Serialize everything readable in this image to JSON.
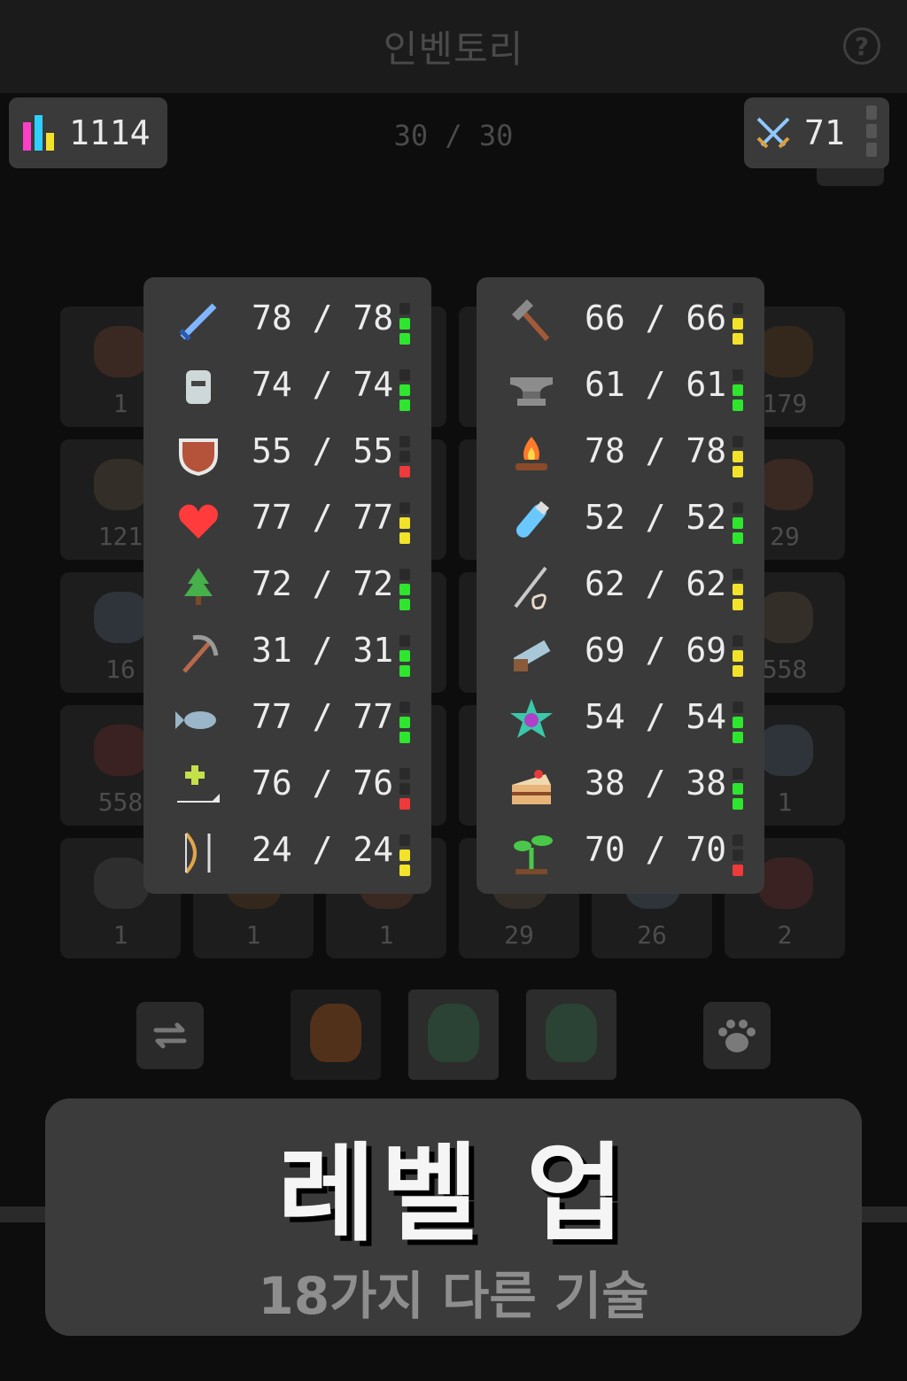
{
  "header": {
    "title": "인벤토리",
    "help_label": "?"
  },
  "player": {
    "total_level": "1114",
    "combat_level": "71"
  },
  "inventory": {
    "count_label": "30 / 30",
    "visible_quantities": [
      [
        "1",
        "",
        "",
        "",
        "",
        "179"
      ],
      [
        "121",
        "",
        "",
        "",
        "",
        "29"
      ],
      [
        "16",
        "",
        "",
        "",
        "",
        "558"
      ],
      [
        "558",
        "",
        "",
        "",
        "",
        "1"
      ],
      [
        "1",
        "1",
        "1",
        "29",
        "26",
        "2"
      ]
    ]
  },
  "skills_left": [
    {
      "icon": "sword-icon",
      "value": "78 / 78",
      "meter": "green",
      "color": "#7fb6ff"
    },
    {
      "icon": "helmet-icon",
      "value": "74 / 74",
      "meter": "green",
      "color": "#cfd8d8"
    },
    {
      "icon": "shield-icon",
      "value": "55 / 55",
      "meter": "red",
      "color": "#b5533a"
    },
    {
      "icon": "heart-icon",
      "value": "77 / 77",
      "meter": "yellow",
      "color": "#ff3b3b"
    },
    {
      "icon": "tree-icon",
      "value": "72 / 72",
      "meter": "green",
      "color": "#46b04a"
    },
    {
      "icon": "pickaxe-icon",
      "value": "31 / 31",
      "meter": "green",
      "color": "#b8684a"
    },
    {
      "icon": "fish-icon",
      "value": "77 / 77",
      "meter": "green",
      "color": "#9ab6c8"
    },
    {
      "icon": "healing-hand-icon",
      "value": "76 / 76",
      "meter": "red",
      "color": "#c4e04a"
    },
    {
      "icon": "bow-icon",
      "value": "24 / 24",
      "meter": "yellow",
      "color": "#e0a64a"
    }
  ],
  "skills_right": [
    {
      "icon": "hammer-icon",
      "value": "66 / 66",
      "meter": "yellow",
      "color": "#a35a3a"
    },
    {
      "icon": "anvil-icon",
      "value": "61 / 61",
      "meter": "green",
      "color": "#8c8c8c"
    },
    {
      "icon": "campfire-icon",
      "value": "78 / 78",
      "meter": "yellow",
      "color": "#ff7a2a"
    },
    {
      "icon": "potion-icon",
      "value": "52 / 52",
      "meter": "green",
      "color": "#6ac8ff"
    },
    {
      "icon": "needle-icon",
      "value": "62 / 62",
      "meter": "yellow",
      "color": "#c8c8c8"
    },
    {
      "icon": "saw-icon",
      "value": "69 / 69",
      "meter": "yellow",
      "color": "#a8c8d8"
    },
    {
      "icon": "magic-star-icon",
      "value": "54 / 54",
      "meter": "green",
      "color": "#b040c8"
    },
    {
      "icon": "cake-icon",
      "value": "38 / 38",
      "meter": "green",
      "color": "#e8b478"
    },
    {
      "icon": "sprout-icon",
      "value": "70 / 70",
      "meter": "red",
      "color": "#4ac84a"
    }
  ],
  "toolbar": {
    "swap": "swap-icon",
    "pet": "paw-icon"
  },
  "banner": {
    "title": "레벨 업",
    "subtitle": "18가지 다른 기술"
  },
  "colors": {
    "meter_green": "#2ee62e",
    "meter_yellow": "#f2e22a",
    "meter_red": "#ee3a3a",
    "meter_empty": "#2a2a2a"
  }
}
